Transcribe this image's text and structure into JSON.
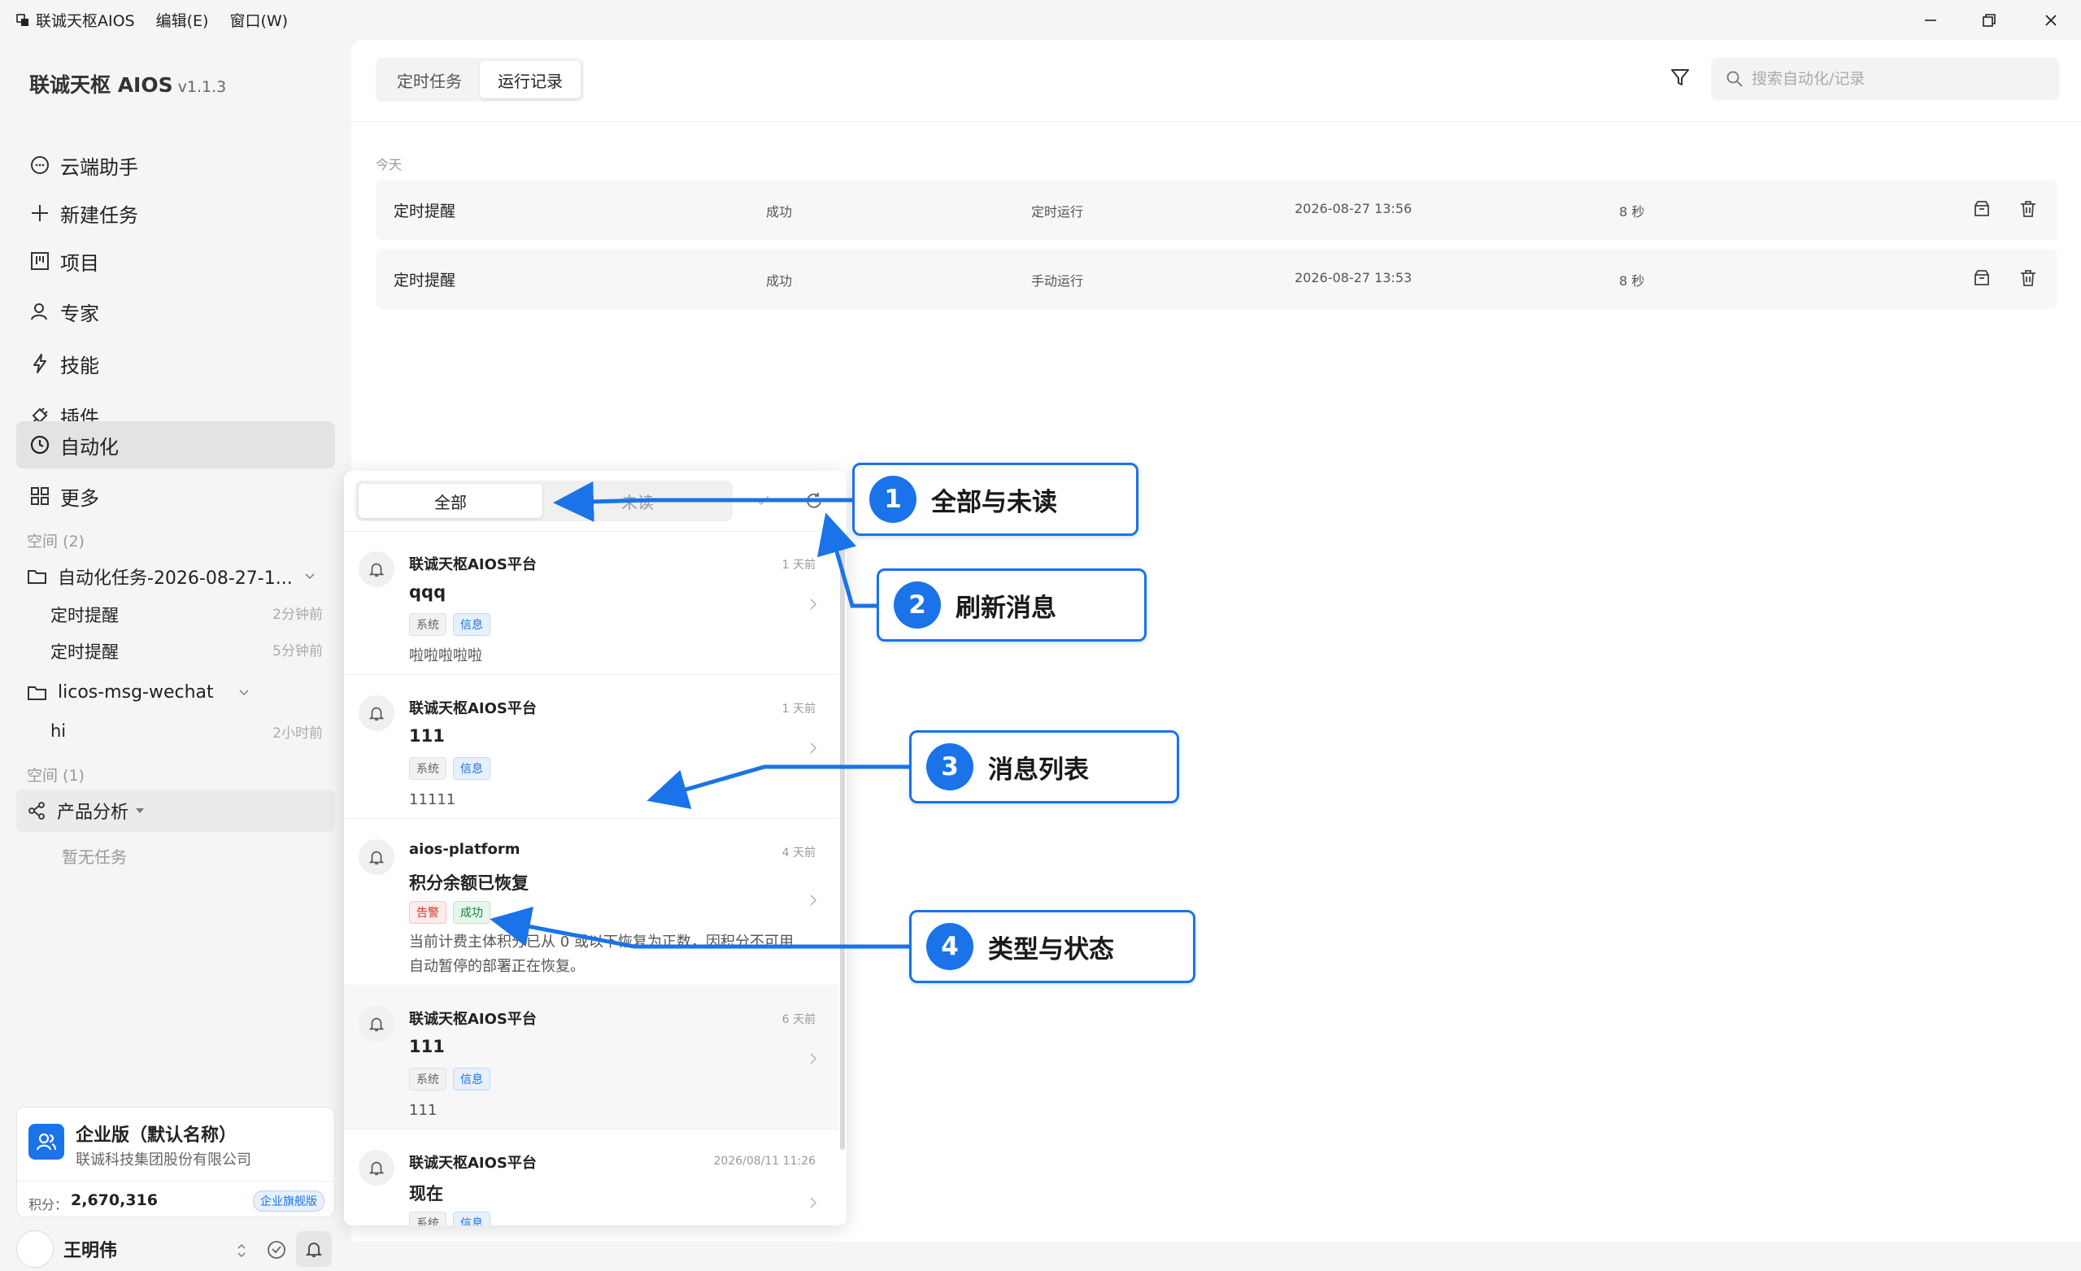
{
  "window": {
    "app_name": "联诚天枢AIOS",
    "menus": [
      "编辑(E)",
      "窗口(W)"
    ]
  },
  "sidebar": {
    "brand": "联诚天枢 AIOS",
    "version": "v1.1.3",
    "nav": [
      "云端助手",
      "新建任务",
      "项目",
      "专家",
      "技能",
      "插件",
      "自动化",
      "更多"
    ],
    "active_nav": "自动化",
    "space_label_1": "空间 (2)",
    "folder_1": "自动化任务-2026-08-27-1...",
    "folder_1_tasks": [
      {
        "name": "定时提醒",
        "time": "2分钟前"
      },
      {
        "name": "定时提醒",
        "time": "5分钟前"
      }
    ],
    "folder_2": "licos-msg-wechat",
    "folder_2_tasks": [
      {
        "name": "hi",
        "time": "2小时前"
      }
    ],
    "space_label_2": "空间 (1)",
    "project": "产品分析",
    "empty_text": "暂无任务",
    "enterprise": {
      "name": "企业版（默认名称）",
      "company": "联诚科技集团股份有限公司",
      "points_label": "积分：",
      "points": "2,670,316",
      "badge": "企业旗舰版"
    },
    "user": "王明伟"
  },
  "main": {
    "tabs": [
      "定时任务",
      "运行记录"
    ],
    "active_tab": "运行记录",
    "search_placeholder": "搜索自动化/记录",
    "group_label": "今天",
    "records": [
      {
        "name": "定时提醒",
        "status": "成功",
        "trigger": "定时运行",
        "time": "2026-08-27 13:56",
        "duration": "8 秒"
      },
      {
        "name": "定时提醒",
        "status": "成功",
        "trigger": "手动运行",
        "time": "2026-08-27 13:53",
        "duration": "8 秒"
      }
    ]
  },
  "notifications": {
    "tab_all": "全部",
    "tab_unread": "未读",
    "items": [
      {
        "source": "联诚天枢AIOS平台",
        "time": "1 天前",
        "title": "qqq",
        "tags": [
          "系统",
          "信息"
        ],
        "body": "啦啦啦啦啦"
      },
      {
        "source": "联诚天枢AIOS平台",
        "time": "1 天前",
        "title": "111",
        "tags": [
          "系统",
          "信息"
        ],
        "body": "11111"
      },
      {
        "source": "aios-platform",
        "time": "4 天前",
        "title": "积分余额已恢复",
        "tags": [
          "告警",
          "成功"
        ],
        "body": "当前计费主体积分已从 0 或以下恢复为正数，因积分不可用自动暂停的部署正在恢复。"
      },
      {
        "source": "联诚天枢AIOS平台",
        "time": "6 天前",
        "title": "111",
        "tags": [
          "系统",
          "信息"
        ],
        "body": "111"
      },
      {
        "source": "联诚天枢AIOS平台",
        "time": "2026/08/11 11:26",
        "title": "现在",
        "tags": [
          "系统",
          "信息"
        ],
        "body": ""
      }
    ]
  },
  "callouts": [
    {
      "num": "1",
      "label": "全部与未读"
    },
    {
      "num": "2",
      "label": "刷新消息"
    },
    {
      "num": "3",
      "label": "消息列表"
    },
    {
      "num": "4",
      "label": "类型与状态"
    }
  ],
  "colors": {
    "accent": "#1a73e8",
    "active_nav": "#e3e3e3",
    "warn": "#d93025",
    "ok": "#188038"
  }
}
